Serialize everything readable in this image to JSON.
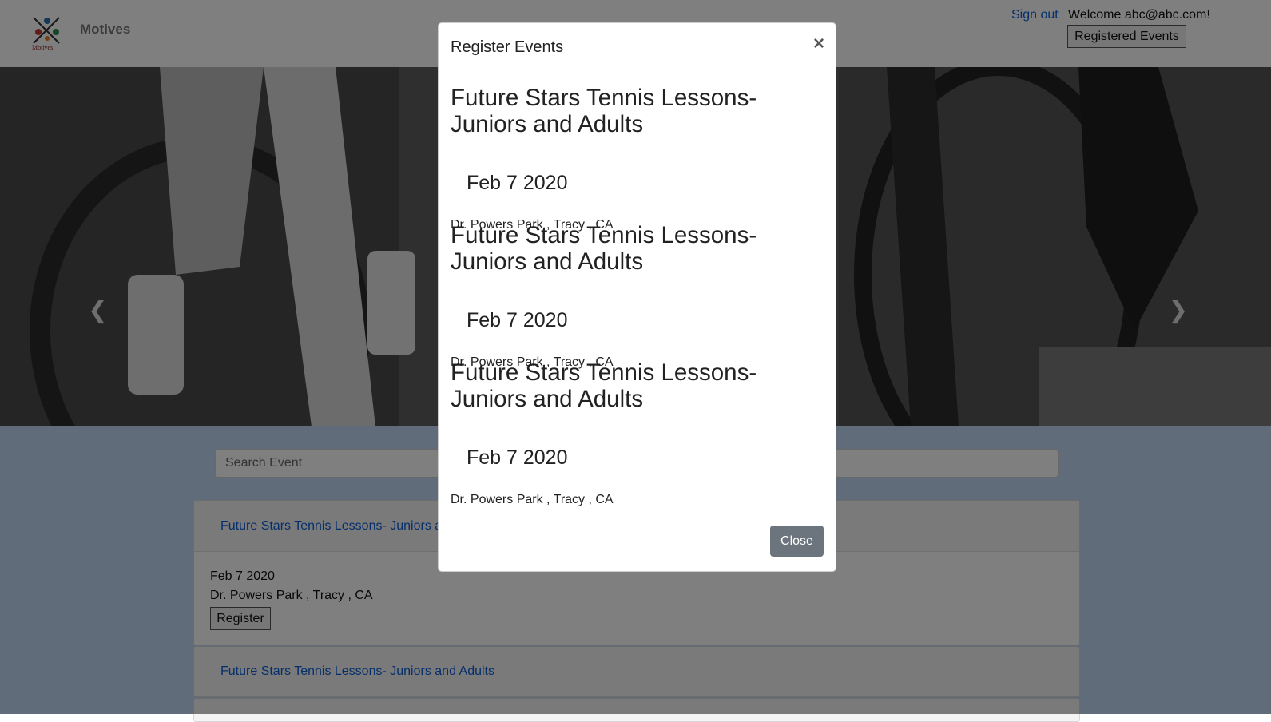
{
  "navbar": {
    "brand": "Motives",
    "logo_caption": "Motives",
    "signout_label": "Sign out",
    "welcome_text": "Welcome abc@abc.com!",
    "registered_events_label": "Registered Events"
  },
  "carousel": {
    "prev_icon": "chevron-left-icon",
    "next_icon": "chevron-right-icon"
  },
  "search": {
    "placeholder": "Search Event"
  },
  "events_list": [
    {
      "title": "Future Stars Tennis Lessons- Juniors and Adults",
      "date": "Feb 7 2020",
      "location": "Dr. Powers Park , Tracy , CA",
      "register_label": "Register"
    },
    {
      "title": "Future Stars Tennis Lessons- Juniors and Adults"
    }
  ],
  "modal": {
    "title": "Register Events",
    "close_x": "×",
    "close_label": "Close",
    "events": [
      {
        "title": "Future Stars Tennis Lessons- Juniors and Adults",
        "date": "Feb 7 2020",
        "location": "Dr. Powers Park , Tracy , CA"
      },
      {
        "title": "Future Stars Tennis Lessons- Juniors and Adults",
        "date": "Feb 7 2020",
        "location": "Dr. Powers Park , Tracy , CA"
      },
      {
        "title": "Future Stars Tennis Lessons- Juniors and Adults",
        "date": "Feb 7 2020",
        "location": "Dr. Powers Park , Tracy , CA"
      }
    ]
  },
  "colors": {
    "link": "#0b5ed7",
    "page_background": "#c3d9f7",
    "close_button": "#6c757d",
    "backdrop": "rgba(0,0,0,0.5)"
  }
}
